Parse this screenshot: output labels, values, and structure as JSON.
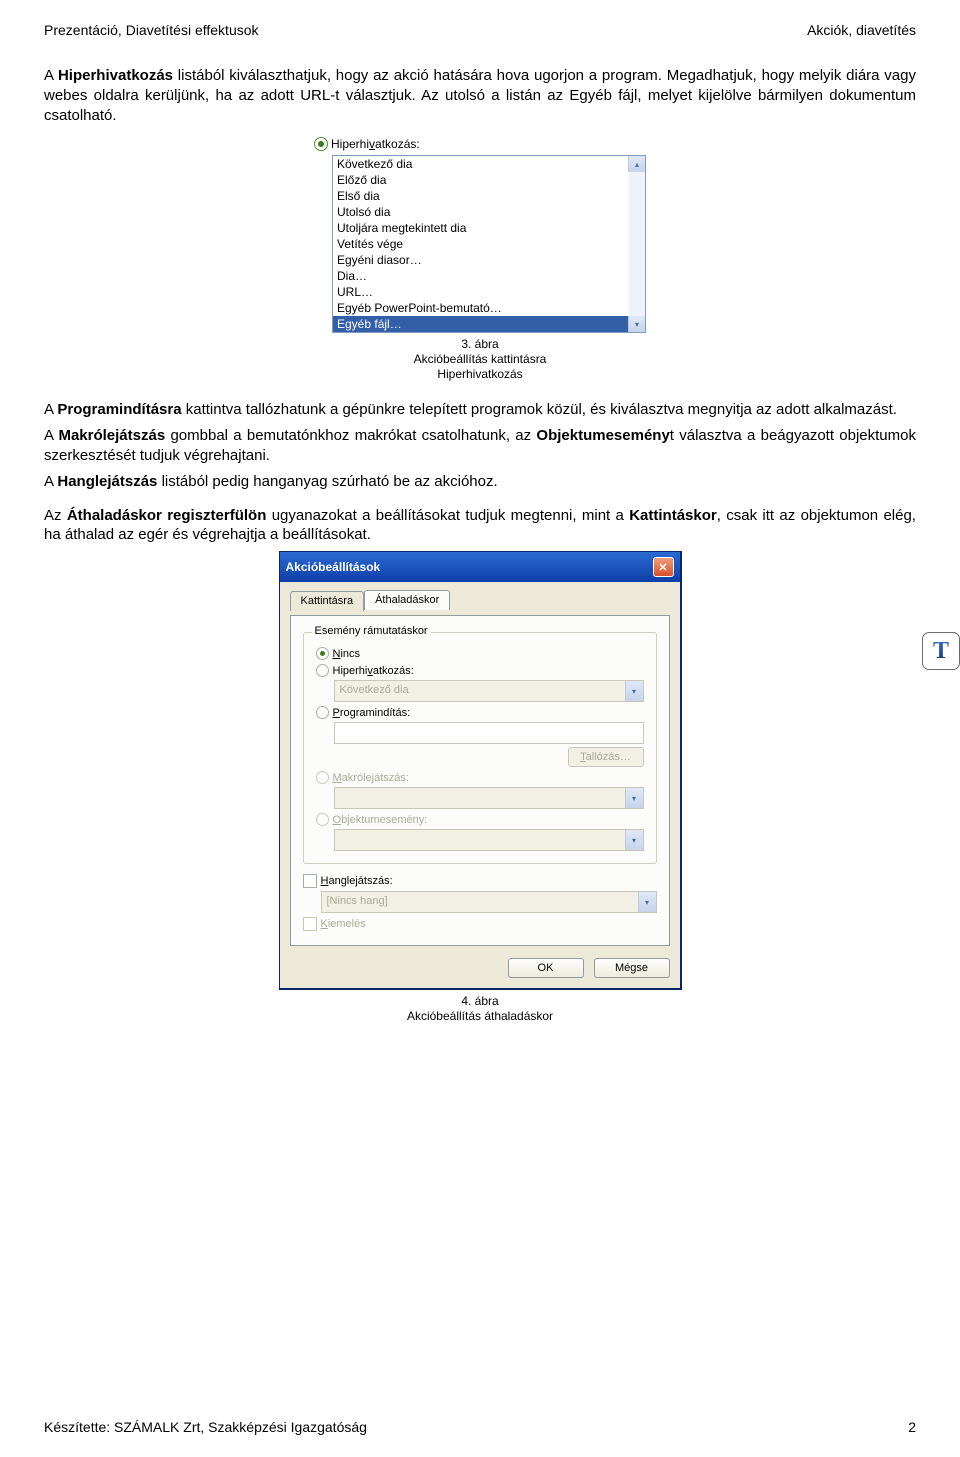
{
  "header": {
    "left": "Prezentáció, Diavetítési effektusok",
    "right": "Akciók, diavetítés"
  },
  "para1_pre": "A ",
  "para1_b1": "Hiperhivatkozás",
  "para1_mid": " listából kiválaszthatjuk, hogy az akció hatására hova ugorjon a program. Megadhatjuk, hogy melyik diára vagy webes oldalra kerüljünk, ha az adott URL-t választjuk. Az utolsó a listán az Egyéb fájl, melyet kijelölve bármilyen dokumentum csatolható.",
  "shot1": {
    "radio_label": "Hiperhivatkozás:",
    "items": [
      "Következő dia",
      "Előző dia",
      "Első dia",
      "Utolsó dia",
      "Utoljára megtekintett dia",
      "Vetítés vége",
      "Egyéni diasor…",
      "Dia…",
      "URL…",
      "Egyéb PowerPoint-bemutató…",
      "Egyéb fájl…"
    ],
    "selected_index": 10
  },
  "cap1": {
    "line1": "3. ábra",
    "line2": "Akcióbeállítás kattintásra",
    "line3": "Hiperhivatkozás"
  },
  "para2_pre": "A ",
  "para2_b1": "Programindításra",
  "para2_mid1": " kattintva tallózhatunk a gépünkre telepített programok közül, és kiválasztva megnyitja az adott alkalmazást.",
  "para3_pre": "A ",
  "para3_b1": "Makrólejátszás",
  "para3_mid": " gombbal a bemutatónkhoz makrókat csatolhatunk, az ",
  "para3_b2": "Objektumesemény",
  "para3_post": "t választva a beágyazott objektumok szerkesztését tudjuk végrehajtani.",
  "para4_pre": "A ",
  "para4_b1": "Hanglejátszás",
  "para4_post": " listából pedig hanganyag szúrható be az akcióhoz.",
  "para5_pre": "Az ",
  "para5_b1": "Áthaladáskor regiszterfülön",
  "para5_post1": " ugyanazokat a beállításokat tudjuk megtenni, mint a ",
  "para5_b2": "Kattintáskor",
  "para5_post2": ", csak itt az objektumon elég, ha áthalad az egér és végrehajtja a beállításokat.",
  "badge_letter": "T",
  "dlg": {
    "title": "Akcióbeállítások",
    "tab_inactive": "Kattintásra",
    "tab_active": "Áthaladáskor",
    "group_label": "Esemény rámutatáskor",
    "opt_none": "Nincs",
    "opt_hyper": "Hiperhivatkozás:",
    "hyper_value": "Következő dia",
    "opt_prog": "Programindítás:",
    "browse_btn": "Tallózás…",
    "opt_macro": "Makrólejátszás:",
    "opt_obj": "Objektumesemény:",
    "chk_sound": "Hanglejátszás:",
    "sound_value": "[Nincs hang]",
    "chk_highlight": "Kiemelés",
    "btn_ok": "OK",
    "btn_cancel": "Mégse"
  },
  "cap2": {
    "line1": "4. ábra",
    "line2": "Akcióbeállítás áthaladáskor"
  },
  "footer": {
    "left": "Készítette: SZÁMALK Zrt, Szakképzési Igazgatóság",
    "right": "2"
  }
}
